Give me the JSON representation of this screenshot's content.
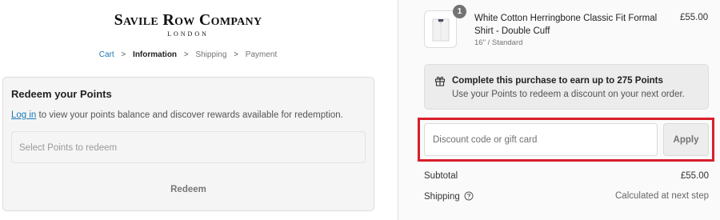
{
  "brand": {
    "name": "Savile Row Company",
    "sub": "LONDON"
  },
  "breadcrumb": {
    "items": [
      {
        "label": "Cart"
      },
      {
        "label": "Information"
      },
      {
        "label": "Shipping"
      },
      {
        "label": "Payment"
      }
    ],
    "separator": ">"
  },
  "points": {
    "title": "Redeem your Points",
    "login_link": "Log in",
    "desc_rest": " to view your points balance and discover rewards available for redemption.",
    "select_placeholder": "Select Points to redeem",
    "redeem_label": "Redeem"
  },
  "product": {
    "quantity": "1",
    "name": "White Cotton Herringbone Classic Fit Formal Shirt - Double Cuff",
    "variant": "16\" / Standard",
    "price": "£55.00"
  },
  "rewards_banner": {
    "title": "Complete this purchase to earn up to 275 Points",
    "subtitle": "Use your Points to redeem a discount on your next order."
  },
  "discount": {
    "placeholder": "Discount code or gift card",
    "apply_label": "Apply",
    "highlight_color": "#d91e2b"
  },
  "summary": {
    "subtotal_label": "Subtotal",
    "subtotal_value": "£55.00",
    "shipping_label": "Shipping",
    "shipping_value": "Calculated at next step"
  },
  "colors": {
    "link": "#1979b5",
    "accent": "#d91e2b"
  },
  "icons": {
    "gift": "gift-icon",
    "help": "help-icon",
    "chevron": "chevron-right-icon"
  }
}
